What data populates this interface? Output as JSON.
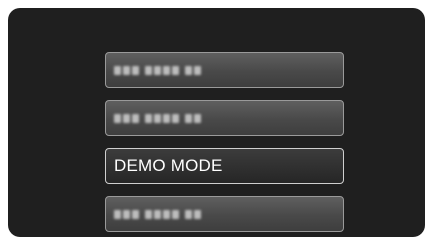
{
  "menu": {
    "items": [
      {
        "label": "",
        "selected": false,
        "blurred": true
      },
      {
        "label": "",
        "selected": false,
        "blurred": true
      },
      {
        "label": "DEMO MODE",
        "selected": true,
        "blurred": false
      },
      {
        "label": "",
        "selected": false,
        "blurred": true
      }
    ]
  },
  "colors": {
    "screen_background": "#1f1f1f",
    "item_background": "#4a4a4a",
    "selected_background": "#2a2a2a",
    "item_border": "#9a9a9a",
    "text": "#ffffff"
  }
}
